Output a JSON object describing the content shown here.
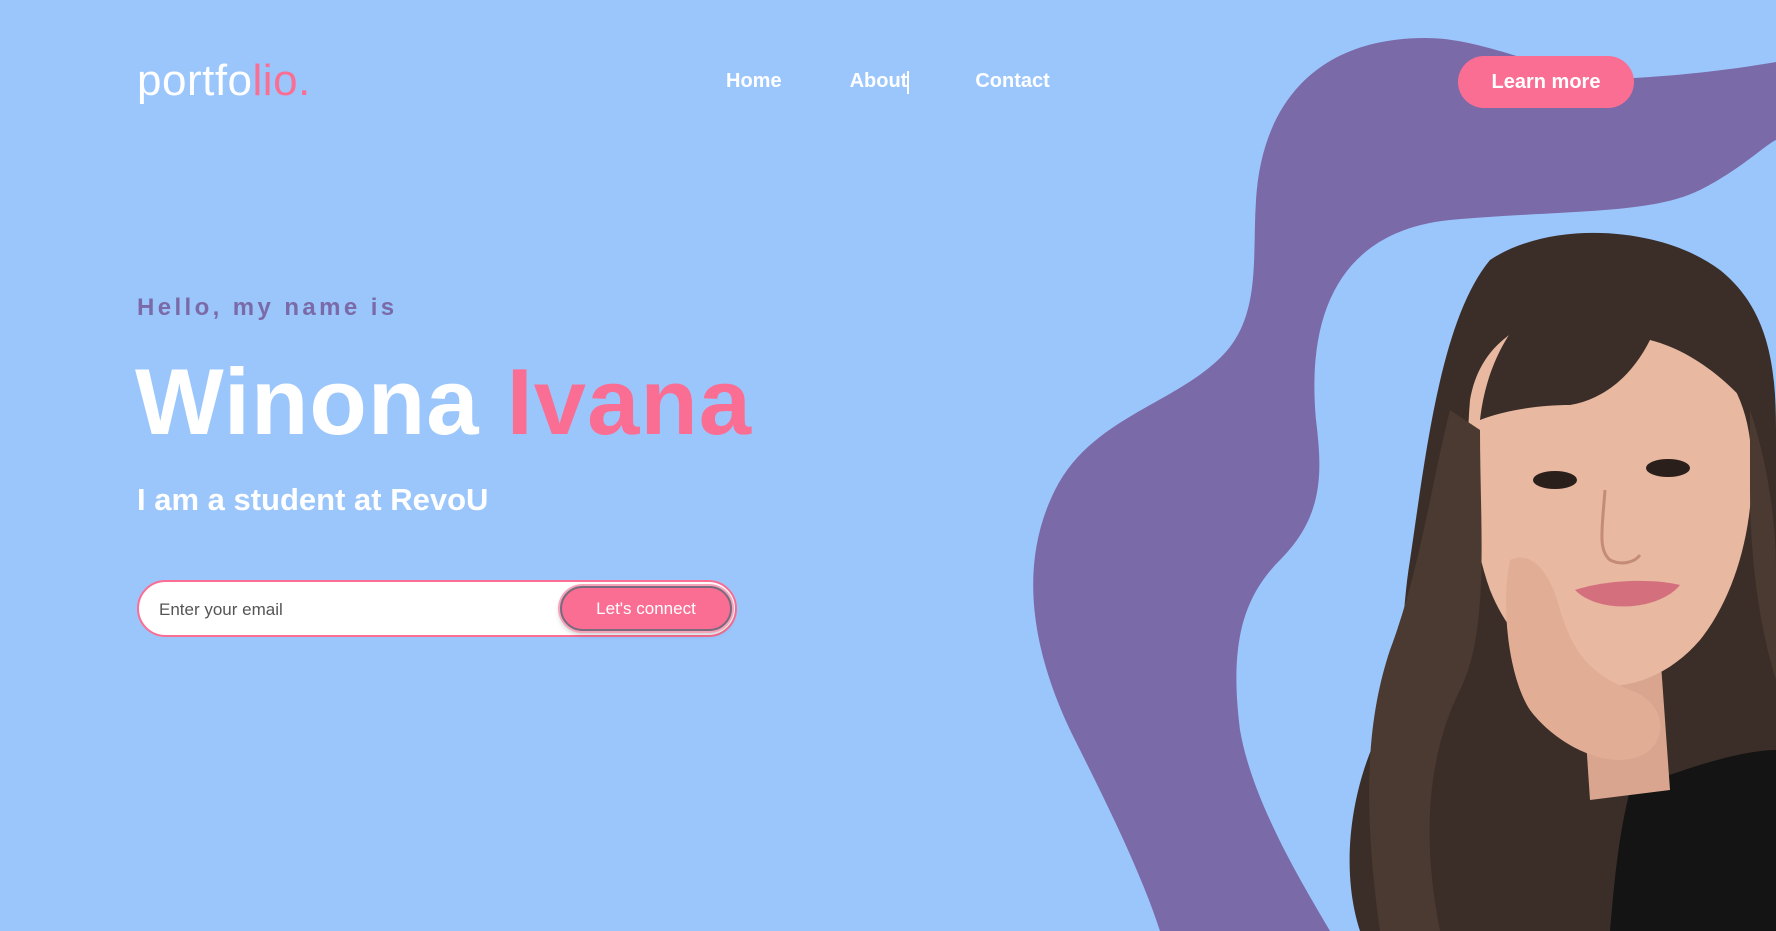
{
  "brand": {
    "logo_main": "portfo",
    "logo_accent": "lio."
  },
  "nav": {
    "items": [
      "Home",
      "About",
      "Contact"
    ]
  },
  "header": {
    "cta_label": "Learn more"
  },
  "hero": {
    "greeting": "Hello, my name is",
    "first_name": "Winona",
    "last_name": "Ivana",
    "subtitle": "I am a student at RevoU"
  },
  "form": {
    "email_placeholder": "Enter your email",
    "submit_label": "Let's connect"
  },
  "colors": {
    "background": "#9bc6fc",
    "accent_pink": "#fb6e94",
    "accent_purple": "#7b6aa8",
    "text_light": "#ffffff"
  },
  "icons": {
    "portrait": "person-photo"
  }
}
